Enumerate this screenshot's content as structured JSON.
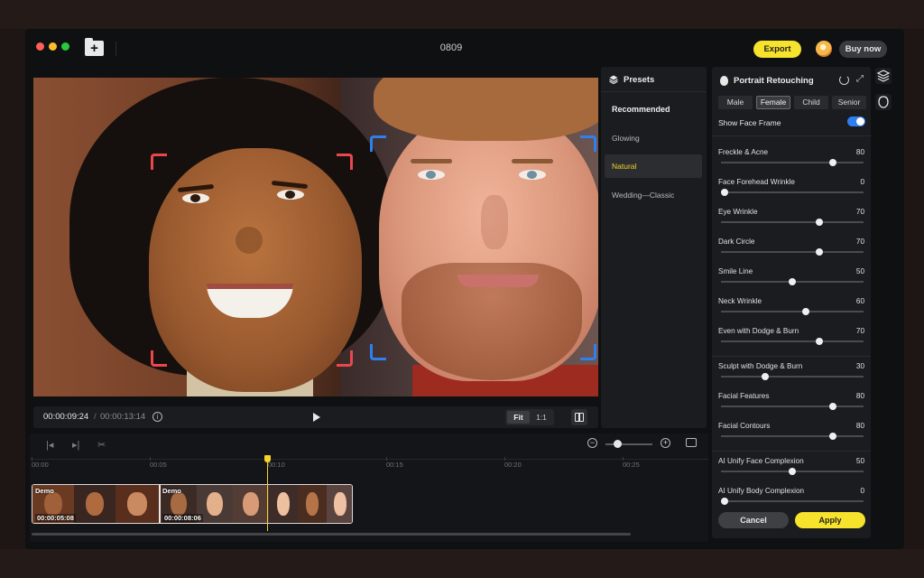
{
  "window": {
    "title": "0809"
  },
  "header": {
    "export_label": "Export",
    "buy_label": "Buy now"
  },
  "playback": {
    "current_time": "00:00:09:24",
    "separator": "/",
    "total_time": "00:00:13:14",
    "fit_label": "Fit",
    "actual_label": "1:1"
  },
  "timeline": {
    "ticks": [
      "00:00",
      "00:05",
      "00:10",
      "00:15",
      "00:20",
      "00:25"
    ],
    "clips": [
      {
        "label": "Demo",
        "timecode": "00:00:05:08"
      },
      {
        "label": "Demo",
        "timecode": "00:00:08:06"
      }
    ],
    "zoom_level": 0.2,
    "playhead_time": "00:00:09:24"
  },
  "presets": {
    "title": "Presets",
    "items": [
      {
        "label": "Recommended",
        "kind": "header"
      },
      {
        "label": "Glowing",
        "selected": false
      },
      {
        "label": "Natural",
        "selected": true
      },
      {
        "label": "Wedding—Classic",
        "selected": false
      }
    ]
  },
  "retouch": {
    "title": "Portrait Retouching",
    "genders": [
      "Male",
      "Female",
      "Child",
      "Senior"
    ],
    "selected_gender": "Female",
    "show_face_frame_label": "Show Face Frame",
    "show_face_frame": true,
    "sliders": [
      {
        "label": "Freckle & Acne",
        "value": 80
      },
      {
        "label": "Face Forehead Wrinkle",
        "value": 0
      },
      {
        "label": "Eye Wrinkle",
        "value": 70
      },
      {
        "label": "Dark Circle",
        "value": 70
      },
      {
        "label": "Smile Line",
        "value": 50
      },
      {
        "label": "Neck Wrinkle",
        "value": 60
      },
      {
        "label": "Even with Dodge & Burn",
        "value": 70
      },
      {
        "label": "Sculpt with Dodge & Burn",
        "value": 30
      },
      {
        "label": "Facial Features",
        "value": 80
      },
      {
        "label": "Facial Contours",
        "value": 80
      },
      {
        "label": "AI Unify Face Complexion",
        "value": 50
      },
      {
        "label": "AI Unify Body Complexion",
        "value": 0
      }
    ],
    "cancel_label": "Cancel",
    "apply_label": "Apply"
  },
  "colors": {
    "accent_yellow": "#f7e22c",
    "toggle_blue": "#2f7ff0",
    "face_frame_red": "#e9474d",
    "face_frame_blue": "#2f7ff0"
  },
  "icons": [
    "folder-add-icon",
    "info-icon",
    "play-icon",
    "compare-icon",
    "trim-start-icon",
    "trim-end-icon",
    "scissors-icon",
    "zoom-out-icon",
    "zoom-in-icon",
    "fit-timeline-icon",
    "layers-icon",
    "face-retouch-icon",
    "reset-icon",
    "expand-icon"
  ]
}
